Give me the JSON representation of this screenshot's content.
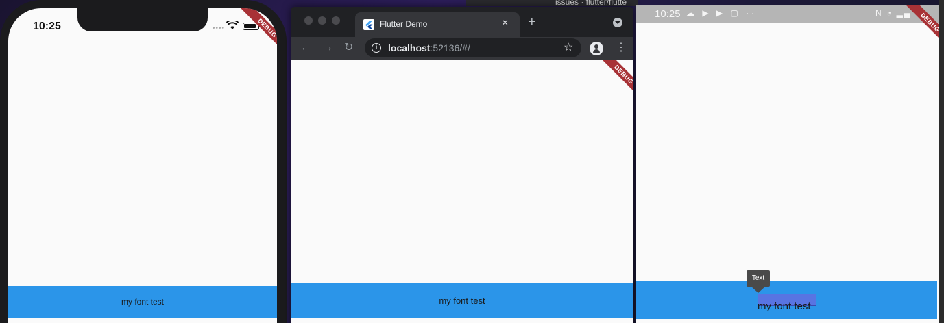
{
  "desktop": {
    "behind_window_title": "issues · flutter/flutte"
  },
  "debug_banner": "DEBUG",
  "ios": {
    "time": "10:25",
    "bar_text": "my font test"
  },
  "chrome": {
    "tab_title": "Flutter Demo",
    "tab_close": "×",
    "new_tab": "+",
    "url_host": "localhost",
    "url_rest": ":52136/#/",
    "back": "←",
    "forward": "→",
    "reload": "↻",
    "info": "i",
    "star": "☆",
    "menu": "⋮",
    "bar_text": "my font test"
  },
  "android": {
    "time": "10:25",
    "status_left_icons": "☁ ▶ ▶ ▢ ··",
    "status_right_icons": "N ◔ ▂▄",
    "tooltip": "Text",
    "bar_text": "my font test"
  },
  "colors": {
    "app_bar_blue": "#2b95e9",
    "debug_red": "#a83236",
    "chrome_dark": "#202124",
    "chrome_toolbar": "#35363a",
    "selection": "#606ee1"
  },
  "icons": [
    "wifi-icon",
    "battery-icon",
    "info-icon",
    "star-icon",
    "profile-icon",
    "menu-icon",
    "flutter-favicon"
  ]
}
